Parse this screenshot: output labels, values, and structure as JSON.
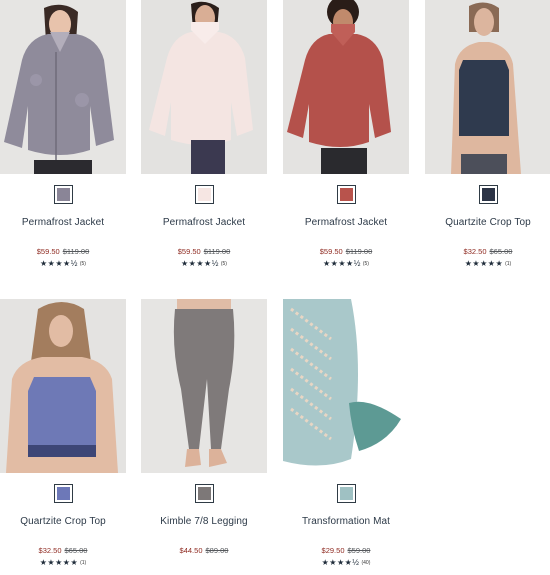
{
  "products": [
    {
      "name": "Permafrost Jacket",
      "sale": "$59.50",
      "orig": "$119.00",
      "stars": 4.5,
      "count": "(5)",
      "swatch": "#8a8597"
    },
    {
      "name": "Permafrost Jacket",
      "sale": "$59.50",
      "orig": "$119.00",
      "stars": 4.5,
      "count": "(5)",
      "swatch": "#f6e6e3"
    },
    {
      "name": "Permafrost Jacket",
      "sale": "$59.50",
      "orig": "$119.00",
      "stars": 4.5,
      "count": "(5)",
      "swatch": "#b8534c"
    },
    {
      "name": "Quartzite Crop Top",
      "sale": "$32.50",
      "orig": "$65.00",
      "stars": 5,
      "count": "(1)",
      "swatch": "#2c3446"
    },
    {
      "name": "Quartzite Crop Top",
      "sale": "$32.50",
      "orig": "$65.00",
      "stars": 5,
      "count": "(1)",
      "swatch": "#6d78b8"
    },
    {
      "name": "Kimble 7/8 Legging",
      "sale": "$44.50",
      "orig": "$89.00",
      "stars": 0,
      "count": "",
      "swatch": "#7d7878"
    },
    {
      "name": "Transformation Mat",
      "sale": "$29.50",
      "orig": "$59.00",
      "stars": 4.5,
      "count": "(40)",
      "swatch": "#9fc1c3"
    }
  ]
}
